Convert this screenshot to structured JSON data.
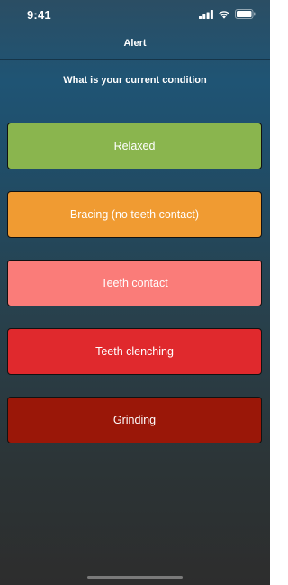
{
  "status_bar": {
    "time": "9:41"
  },
  "nav": {
    "title": "Alert"
  },
  "question": "What is your current condition",
  "options": [
    {
      "label": "Relaxed",
      "color": "#8ab54e"
    },
    {
      "label": "Bracing (no teeth contact)",
      "color": "#f09b32"
    },
    {
      "label": "Teeth contact",
      "color": "#fa7c79"
    },
    {
      "label": "Teeth clenching",
      "color": "#e0292d"
    },
    {
      "label": "Grinding",
      "color": "#9a1708"
    }
  ],
  "icons": {
    "signal": "cellular-signal-icon",
    "wifi": "wifi-icon",
    "battery": "battery-icon"
  }
}
